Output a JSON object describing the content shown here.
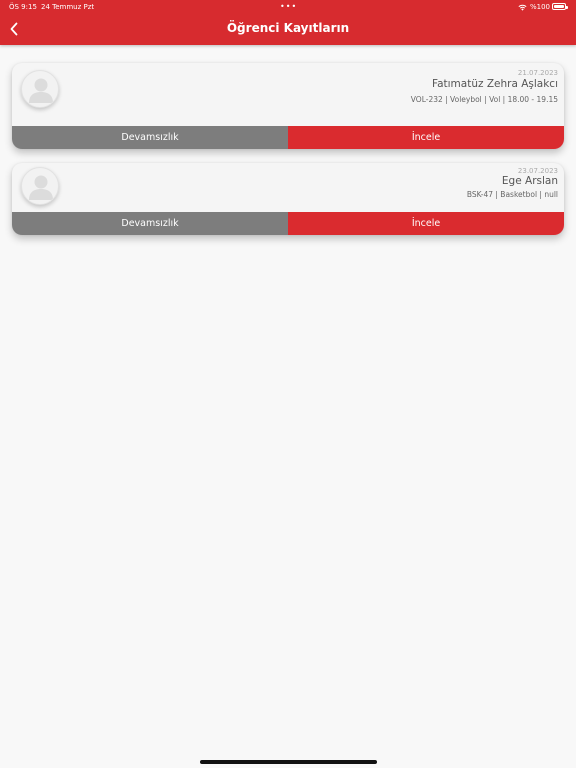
{
  "status_bar": {
    "time": "ÖS 9:15",
    "date": "24 Temmuz Pzt",
    "dots": "•••",
    "battery": "%100"
  },
  "header": {
    "title": "Öğrenci Kayıtların",
    "back_icon": "chevron-left-icon",
    "background": "#d72b2f"
  },
  "registrations": [
    {
      "date": "21.07.2023",
      "name": "Fatımatüz Zehra Aşlakcı",
      "detail": "VOL-232 | Voleybol | Vol | 18.00 - 19.15",
      "attendance_label": "Devamsızlık",
      "review_label": "İncele"
    },
    {
      "date": "23.07.2023",
      "name": "Ege Arslan",
      "detail": "BSK-47 | Basketbol | null",
      "attendance_label": "Devamsızlık",
      "review_label": "İncele"
    }
  ],
  "colors": {
    "accent": "#d72b2f",
    "secondary_button": "#7d7d7d",
    "background": "#f8f8f8"
  }
}
